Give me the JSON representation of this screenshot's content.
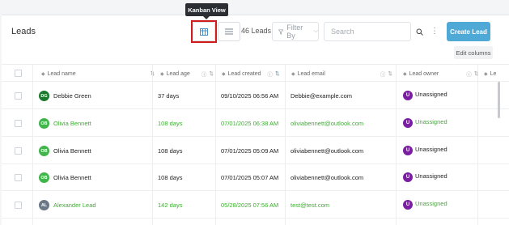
{
  "header": {
    "title": "Leads",
    "count": "46 Leads",
    "filter_label": "Filter By",
    "search_placeholder": "Search",
    "create_label": "Create Lead",
    "edit_columns_label": "Edit columns",
    "kebab_glyph": "⋮",
    "tooltip": "Kanban View"
  },
  "columns": [
    {
      "label": "Lead name"
    },
    {
      "label": "Lead age"
    },
    {
      "label": "Lead created"
    },
    {
      "label": "Lead email"
    },
    {
      "label": "Lead owner"
    },
    {
      "label": "Le"
    }
  ],
  "rows": [
    {
      "initials": "DG",
      "avatar_color": "#1b7a2e",
      "name": "Debbie Green",
      "age": "37 days",
      "created": "09/10/2025 06:56 AM",
      "email": "Debbie@example.com",
      "owner_initial": "U",
      "owner": "Unassigned",
      "highlight": false
    },
    {
      "initials": "OB",
      "avatar_color": "#3fb54a",
      "name": "Olivia Bennett",
      "age": "108 days",
      "created": "07/01/2025 06:38 AM",
      "email": "oliviabennett@outlook.com",
      "owner_initial": "U",
      "owner": "Unassigned",
      "highlight": true
    },
    {
      "initials": "OB",
      "avatar_color": "#3fb54a",
      "name": "Olivia Bennett",
      "age": "108 days",
      "created": "07/01/2025 05:09 AM",
      "email": "oliviabennett@outlook.com",
      "owner_initial": "U",
      "owner": "Unassigned",
      "highlight": false
    },
    {
      "initials": "OB",
      "avatar_color": "#3fb54a",
      "name": "Olivia Bennett",
      "age": "108 days",
      "created": "07/01/2025 05:07 AM",
      "email": "oliviabennett@outlook.com",
      "owner_initial": "U",
      "owner": "Unassigned",
      "highlight": false
    },
    {
      "initials": "AL",
      "avatar_color": "#6b7785",
      "name": "Alexander Lead",
      "age": "142 days",
      "created": "05/28/2025 07:56 AM",
      "email": "test@test.com",
      "owner_initial": "U",
      "owner": "Unassigned",
      "highlight": true
    }
  ],
  "colors": {
    "highlight_text": "#3bae2f",
    "normal_text": "#222222",
    "create_button": "#4fa9d6",
    "owner_avatar": "#7b1fa2"
  },
  "icons": {
    "kanban": "kanban-view-icon",
    "list": "list-view-icon",
    "filter": "funnel-icon",
    "search": "search-icon"
  }
}
